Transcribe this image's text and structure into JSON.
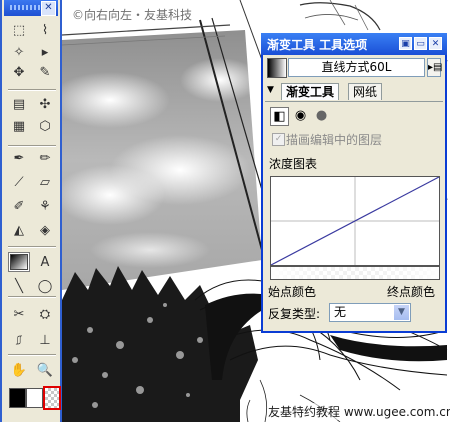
{
  "watermark_top": "©向右向左・友基科技",
  "watermark_bottom": "友基特约教程 www.ugee.com.cn",
  "toolbox": {
    "tools": [
      {
        "name": "rect-marquee-tool",
        "glyph": "⬚",
        "col": 0,
        "row": 0
      },
      {
        "name": "lasso-tool",
        "glyph": "⌇",
        "col": 1,
        "row": 0
      },
      {
        "name": "magic-wand-tool",
        "glyph": "✧",
        "col": 0,
        "row": 1
      },
      {
        "name": "path-select-tool",
        "glyph": "▸",
        "col": 1,
        "row": 1
      },
      {
        "name": "move-tool",
        "glyph": "✥",
        "col": 0,
        "row": 2
      },
      {
        "name": "eyedropper-tool",
        "glyph": "✎",
        "col": 1,
        "row": 2
      },
      {
        "name": "layer-adjust-tool",
        "glyph": "▤",
        "col": 0,
        "row": 3
      },
      {
        "name": "hand-pan-tool",
        "glyph": "✣",
        "col": 1,
        "row": 3
      },
      {
        "name": "grid-tool",
        "glyph": "▦",
        "col": 0,
        "row": 4
      },
      {
        "name": "transform-tool",
        "glyph": "⬡",
        "col": 1,
        "row": 4
      },
      {
        "name": "pen-tool",
        "glyph": "✒",
        "col": 0,
        "row": 5
      },
      {
        "name": "pencil-tool",
        "glyph": "✏",
        "col": 1,
        "row": 5
      },
      {
        "name": "brush-tool",
        "glyph": "⟋",
        "col": 0,
        "row": 6
      },
      {
        "name": "eraser-tool",
        "glyph": "▱",
        "col": 1,
        "row": 6
      },
      {
        "name": "marker-tool",
        "glyph": "✐",
        "col": 0,
        "row": 7
      },
      {
        "name": "airbrush-tool",
        "glyph": "⚘",
        "col": 1,
        "row": 7
      },
      {
        "name": "fill-tool",
        "glyph": "◭",
        "col": 0,
        "row": 8
      },
      {
        "name": "blend-tool",
        "glyph": "◈",
        "col": 1,
        "row": 8
      },
      {
        "name": "gradient-tool",
        "glyph": "",
        "col": 0,
        "row": 9
      },
      {
        "name": "text-tool",
        "glyph": "A",
        "col": 1,
        "row": 9
      },
      {
        "name": "line-tool",
        "glyph": "╲",
        "col": 0,
        "row": 10
      },
      {
        "name": "ellipse-tool",
        "glyph": "◯",
        "col": 1,
        "row": 10
      },
      {
        "name": "tone-tool",
        "glyph": "✂",
        "col": 0,
        "row": 11
      },
      {
        "name": "frame-tool",
        "glyph": "⛭",
        "col": 1,
        "row": 11
      },
      {
        "name": "correction-tool",
        "glyph": "⎎",
        "col": 0,
        "row": 12
      },
      {
        "name": "stamp-tool",
        "glyph": "⊥",
        "col": 1,
        "row": 12
      },
      {
        "name": "hand-tool",
        "glyph": "✋",
        "col": 0,
        "row": 13
      },
      {
        "name": "zoom-tool",
        "glyph": "🔍",
        "col": 1,
        "row": 13
      }
    ]
  },
  "panel": {
    "title": "渐变工具  工具选项",
    "preset": "直线方式60L",
    "tabs": [
      "渐变工具",
      "网纸"
    ],
    "option_edit_layer": "描画编辑中的图层",
    "density_chart_label": "浓度图表",
    "start_color_label": "始点颜色",
    "end_color_label": "终点颜色",
    "repeat_type_label": "反复类型:",
    "repeat_type_value": "无"
  }
}
